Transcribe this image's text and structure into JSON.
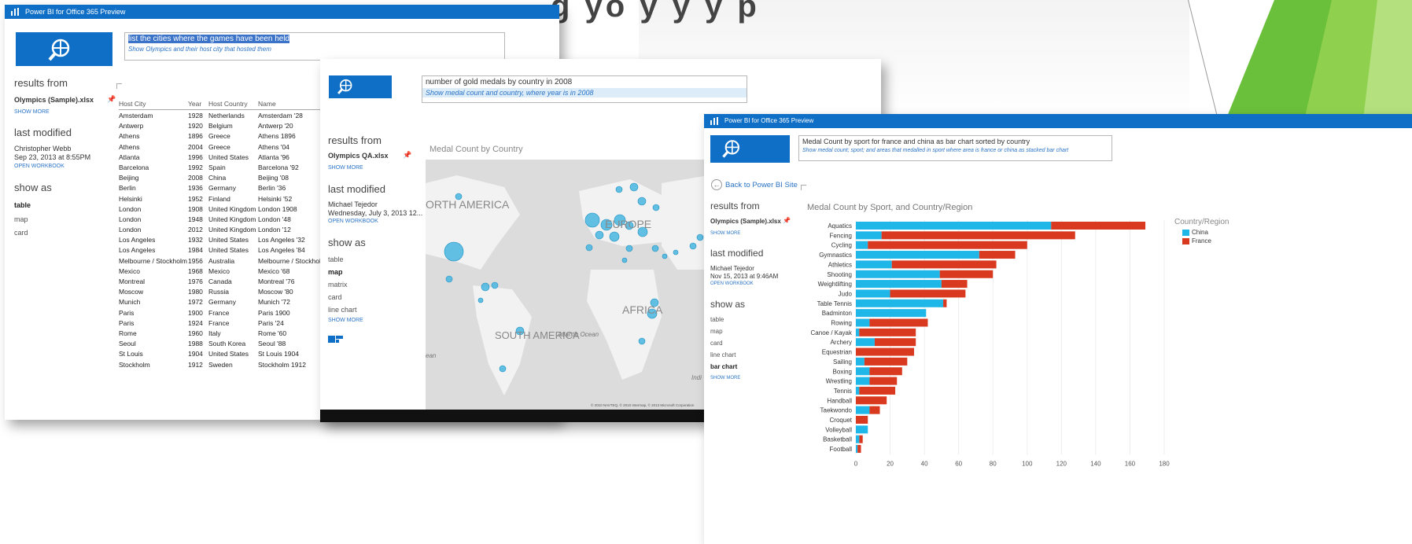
{
  "page": {
    "headline_partial": "g yo   y   y    y    p"
  },
  "colors": {
    "titlebar": "#0f6fc6",
    "china": "#1fb6e8",
    "france": "#d9391e",
    "link": "#2b74c6"
  },
  "window1": {
    "title": "Power BI for Office 365 Preview",
    "query": "list the cities where the games have been held",
    "suggestion": "Show Olympics and their host city that hosted them",
    "results_from_label": "results from",
    "file_name": "Olympics (Sample).xlsx",
    "show_more": "SHOW MORE",
    "last_modified_label": "last modified",
    "modified_by": "Christopher Webb",
    "modified_date": "Sep 23, 2013 at 8:55PM",
    "open_workbook": "OPEN WORKBOOK",
    "show_as_label": "show as",
    "show_as_options": [
      "table",
      "map",
      "card"
    ],
    "selected_option": "table",
    "table": {
      "headers": [
        "Host City",
        "Year",
        "Host Country",
        "Name"
      ],
      "rows": [
        [
          "Amsterdam",
          "1928",
          "Netherlands",
          "Amsterdam '28"
        ],
        [
          "Antwerp",
          "1920",
          "Belgium",
          "Antwerp '20"
        ],
        [
          "Athens",
          "1896",
          "Greece",
          "Athens 1896"
        ],
        [
          "Athens",
          "2004",
          "Greece",
          "Athens '04"
        ],
        [
          "Atlanta",
          "1996",
          "United States",
          "Atlanta '96"
        ],
        [
          "Barcelona",
          "1992",
          "Spain",
          "Barcelona '92"
        ],
        [
          "Beijing",
          "2008",
          "China",
          "Beijing '08"
        ],
        [
          "Berlin",
          "1936",
          "Germany",
          "Berlin '36"
        ],
        [
          "Helsinki",
          "1952",
          "Finland",
          "Helsinki '52"
        ],
        [
          "London",
          "1908",
          "United Kingdom",
          "London 1908"
        ],
        [
          "London",
          "1948",
          "United Kingdom",
          "London '48"
        ],
        [
          "London",
          "2012",
          "United Kingdom",
          "London '12"
        ],
        [
          "Los Angeles",
          "1932",
          "United States",
          "Los Angeles '32"
        ],
        [
          "Los Angeles",
          "1984",
          "United States",
          "Los Angeles '84"
        ],
        [
          "Melbourne / Stockholm",
          "1956",
          "Australia",
          "Melbourne / Stockholm"
        ],
        [
          "Mexico",
          "1968",
          "Mexico",
          "Mexico '68"
        ],
        [
          "Montreal",
          "1976",
          "Canada",
          "Montreal '76"
        ],
        [
          "Moscow",
          "1980",
          "Russia",
          "Moscow '80"
        ],
        [
          "Munich",
          "1972",
          "Germany",
          "Munich '72"
        ],
        [
          "Paris",
          "1900",
          "France",
          "Paris 1900"
        ],
        [
          "Paris",
          "1924",
          "France",
          "Paris '24"
        ],
        [
          "Rome",
          "1960",
          "Italy",
          "Rome '60"
        ],
        [
          "Seoul",
          "1988",
          "South Korea",
          "Seoul '88"
        ],
        [
          "St Louis",
          "1904",
          "United States",
          "St Louis 1904"
        ],
        [
          "Stockholm",
          "1912",
          "Sweden",
          "Stockholm 1912"
        ]
      ]
    }
  },
  "window2": {
    "query": "number of gold medals by country in 2008",
    "suggestion": "Show medal count and country, where year is in 2008",
    "results_from_label": "results from",
    "file_name": "Olympics QA.xlsx",
    "show_more": "SHOW MORE",
    "last_modified_label": "last modified",
    "modified_by": "Michael Tejedor",
    "modified_date": "Wednesday, July 3, 2013 12...",
    "open_workbook": "OPEN WORKBOOK",
    "show_as_label": "show as",
    "show_as_options": [
      "table",
      "map",
      "matrix",
      "card",
      "line chart"
    ],
    "selected_option": "map",
    "show_more_2": "SHOW MORE",
    "map_title": "Medal Count by Country",
    "map_labels": [
      "ORTH AMERICA",
      "EUROPE",
      "AFRICA",
      "SOUTH AMERICA",
      "Atlantic Ocean",
      "Indi",
      "ean"
    ],
    "copyright": "© 2010 NAVTEQ, © 2010 Intermap, © 2013 Microsoft Corporation"
  },
  "window3": {
    "title": "Power BI for Office 365 Preview",
    "query": "Medal Count by sport for france and china as bar chart sorted by country",
    "suggestion": "Show medal count; sport; and areas that medalled in sport where area is france or china as stacked bar chart",
    "back_link": "Back to Power BI Site",
    "results_from_label": "results from",
    "file_name": "Olympics (Sample).xlsx",
    "show_more": "SHOW MORE",
    "last_modified_label": "last modified",
    "modified_by": "Michael Tejedor",
    "modified_date": "Nov 15, 2013 at 9:46AM",
    "open_workbook": "OPEN WORKBOOK",
    "show_as_label": "show as",
    "show_as_options": [
      "table",
      "map",
      "card",
      "line chart",
      "bar chart"
    ],
    "selected_option": "bar chart",
    "show_more_2": "SHOW MORE"
  },
  "chart_data": {
    "type": "bar",
    "orientation": "horizontal",
    "stacked": true,
    "title": "Medal Count by Sport, and Country/Region",
    "legend_title": "Country/Region",
    "legend_position": "right",
    "categories": [
      "Aquatics",
      "Fencing",
      "Cycling",
      "Gymnastics",
      "Athletics",
      "Shooting",
      "Weightlifting",
      "Judo",
      "Table Tennis",
      "Badminton",
      "Rowing",
      "Canoe / Kayak",
      "Archery",
      "Equestrian",
      "Sailing",
      "Boxing",
      "Wrestling",
      "Tennis",
      "Handball",
      "Taekwondo",
      "Croquet",
      "Volleyball",
      "Basketball",
      "Football"
    ],
    "series": [
      {
        "name": "China",
        "color": "#1fb6e8",
        "values": [
          114,
          15,
          7,
          72,
          21,
          49,
          50,
          20,
          51,
          41,
          8,
          2,
          11,
          0,
          5,
          8,
          8,
          2,
          0,
          8,
          0,
          7,
          2,
          1
        ]
      },
      {
        "name": "France",
        "color": "#d9391e",
        "values": [
          55,
          113,
          93,
          21,
          61,
          31,
          15,
          44,
          2,
          0,
          34,
          33,
          24,
          34,
          25,
          19,
          16,
          21,
          18,
          6,
          7,
          0,
          2,
          2
        ]
      }
    ],
    "xlim": [
      0,
      180
    ],
    "xticks": [
      0,
      20,
      40,
      60,
      80,
      100,
      120,
      140,
      160,
      180
    ],
    "grid": true
  }
}
